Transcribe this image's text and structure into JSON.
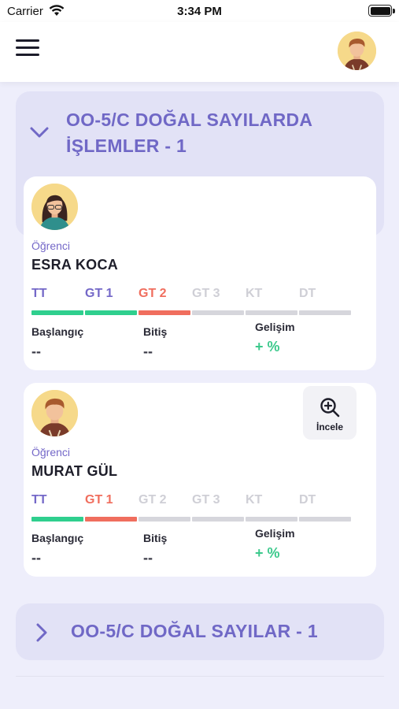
{
  "status_bar": {
    "carrier": "Carrier",
    "time": "3:34 PM"
  },
  "header": {
    "menu_icon": "hamburger-menu-icon",
    "avatar": "user-avatar"
  },
  "groups": [
    {
      "title": "OO-5/C DOĞAL SAYILARDA İŞLEMLER - 1",
      "expanded": true,
      "students": [
        {
          "role": "Öğrenci",
          "name": "ESRA KOCA",
          "stages": [
            {
              "label": "TT",
              "state": "completed"
            },
            {
              "label": "GT 1",
              "state": "completed"
            },
            {
              "label": "GT 2",
              "state": "failed"
            },
            {
              "label": "GT 3",
              "state": "pending"
            },
            {
              "label": "KT",
              "state": "pending"
            },
            {
              "label": "DT",
              "state": "pending"
            }
          ],
          "start_label": "Başlangıç",
          "start_value": "--",
          "end_label": "Bitiş",
          "end_value": "--",
          "progress_label": "Gelişim",
          "progress_value": "+ %"
        },
        {
          "role": "Öğrenci",
          "name": "MURAT GÜL",
          "review_label": "İncele",
          "stages": [
            {
              "label": "TT",
              "state": "completed"
            },
            {
              "label": "GT 1",
              "state": "failed"
            },
            {
              "label": "GT 2",
              "state": "pending"
            },
            {
              "label": "GT 3",
              "state": "pending"
            },
            {
              "label": "KT",
              "state": "pending"
            },
            {
              "label": "DT",
              "state": "pending"
            }
          ],
          "start_label": "Başlangıç",
          "start_value": "--",
          "end_label": "Bitiş",
          "end_value": "--",
          "progress_label": "Gelişim",
          "progress_value": "+ %"
        }
      ]
    },
    {
      "title": "OO-5/C DOĞAL SAYILAR - 1",
      "expanded": false
    }
  ],
  "colors": {
    "accent": "#7068c6",
    "completed": "#2fcf8e",
    "failed": "#f06e5e",
    "pending_text": "#cfcfd6",
    "pending_bar": "#d6d6dc",
    "completed_text": "#7468c8"
  }
}
